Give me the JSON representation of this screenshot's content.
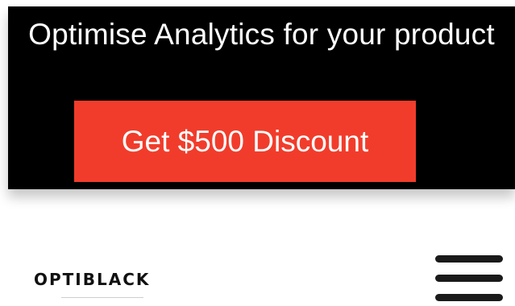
{
  "promo": {
    "title": "Optimise Analytics for your product",
    "cta_label": "Get $500 Discount",
    "background_color": "#000000",
    "cta_color": "#f13c2b"
  },
  "header": {
    "logo_text": "OPTIBLACK",
    "menu_icon": "hamburger-menu-icon"
  }
}
